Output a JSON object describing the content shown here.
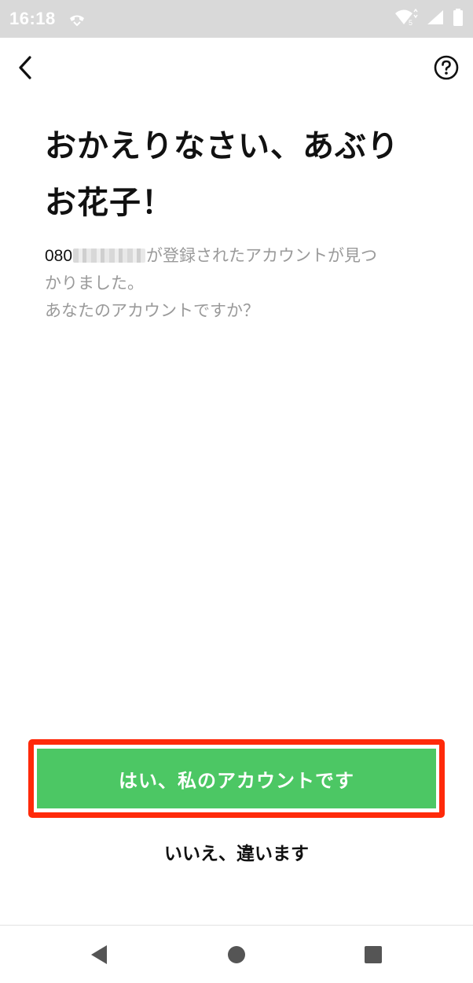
{
  "status_bar": {
    "time": "16:18",
    "network_badge": "5"
  },
  "header": {
    "back_icon": "chevron-left-icon",
    "help_icon": "question-circle-icon"
  },
  "main": {
    "title_line1": "おかえりなさい、あぶり",
    "title_line2": "お花子！",
    "phone_prefix": "080",
    "desc_line1_suffix": "が登録されたアカウントが見つ",
    "desc_line2": "かりました。",
    "desc_line3": "あなたのアカウントですか？"
  },
  "actions": {
    "confirm_label": "はい、私のアカウントです",
    "deny_label": "いいえ、違います"
  },
  "colors": {
    "status_bar_bg": "#d9d9d9",
    "primary_green": "#4cc764",
    "highlight_red": "#ff2a0a",
    "secondary_text": "#9a9a9a"
  }
}
